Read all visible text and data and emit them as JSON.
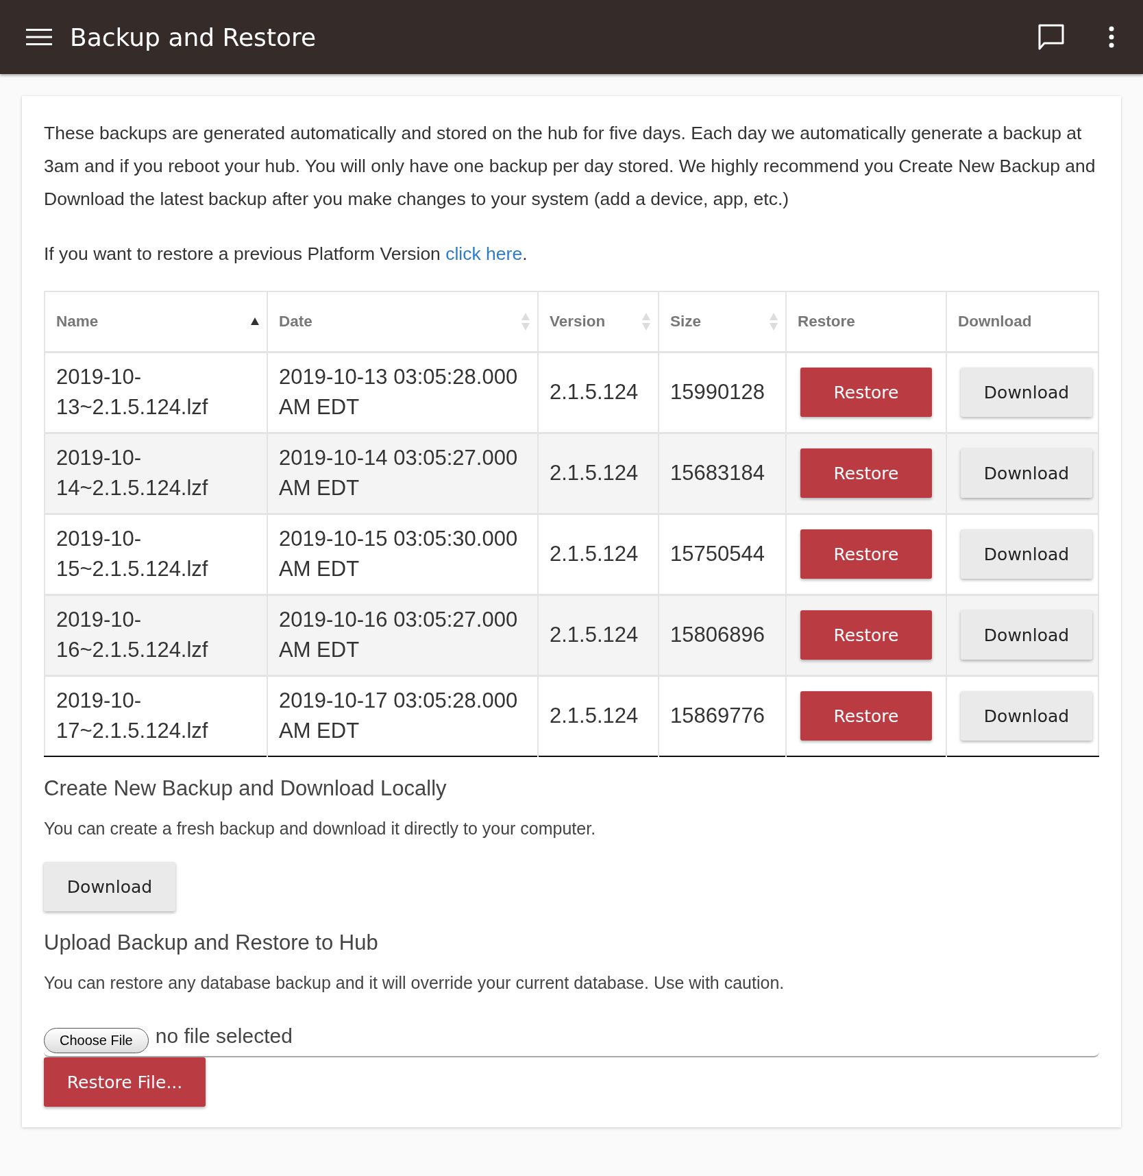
{
  "app_bar": {
    "title": "Backup and Restore"
  },
  "intro": "These backups are generated automatically and stored on the hub for five days. Each day we automatically generate a backup at 3am and if you reboot your hub. You will only have one backup per day stored. We highly recommend you Create New Backup and Download the latest backup after you make changes to your system (add a device, app, etc.)",
  "platform_note": {
    "text": "If you want to restore a previous Platform Version ",
    "link": "click here",
    "suffix": "."
  },
  "table": {
    "columns": [
      {
        "label": "Name",
        "sortable": true,
        "sorted": true
      },
      {
        "label": "Date",
        "sortable": true,
        "sorted": false
      },
      {
        "label": "Version",
        "sortable": true,
        "sorted": false
      },
      {
        "label": "Size",
        "sortable": true,
        "sorted": false
      },
      {
        "label": "Restore",
        "sortable": false,
        "sorted": false
      },
      {
        "label": "Download",
        "sortable": false,
        "sorted": false
      }
    ],
    "rows": [
      {
        "name": "2019-10-13~2.1.5.124.lzf",
        "date": "2019-10-13 03:05:28.000 AM EDT",
        "version": "2.1.5.124",
        "size": "15990128",
        "restore": "Restore",
        "download": "Download"
      },
      {
        "name": "2019-10-14~2.1.5.124.lzf",
        "date": "2019-10-14 03:05:27.000 AM EDT",
        "version": "2.1.5.124",
        "size": "15683184",
        "restore": "Restore",
        "download": "Download"
      },
      {
        "name": "2019-10-15~2.1.5.124.lzf",
        "date": "2019-10-15 03:05:30.000 AM EDT",
        "version": "2.1.5.124",
        "size": "15750544",
        "restore": "Restore",
        "download": "Download"
      },
      {
        "name": "2019-10-16~2.1.5.124.lzf",
        "date": "2019-10-16 03:05:27.000 AM EDT",
        "version": "2.1.5.124",
        "size": "15806896",
        "restore": "Restore",
        "download": "Download"
      },
      {
        "name": "2019-10-17~2.1.5.124.lzf",
        "date": "2019-10-17 03:05:28.000 AM EDT",
        "version": "2.1.5.124",
        "size": "15869776",
        "restore": "Restore",
        "download": "Download"
      }
    ]
  },
  "create_section": {
    "heading": "Create New Backup and Download Locally",
    "text": "You can create a fresh backup and download it directly to your computer.",
    "button": "Download"
  },
  "upload_section": {
    "heading": "Upload Backup and Restore to Hub",
    "text": "You can restore any database backup and it will override your current database. Use with caution.",
    "file_button": "Choose File",
    "file_status": "no file selected",
    "button": "Restore File..."
  }
}
